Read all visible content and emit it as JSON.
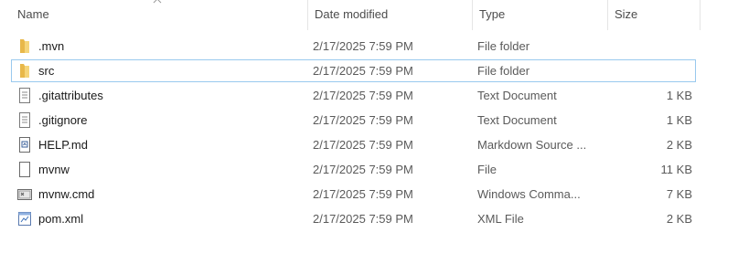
{
  "columns": {
    "name": "Name",
    "date": "Date modified",
    "type": "Type",
    "size": "Size"
  },
  "rows": [
    {
      "name": ".mvn",
      "date": "2/17/2025 7:59 PM",
      "type": "File folder",
      "size": "",
      "icon": "folder-icon"
    },
    {
      "name": "src",
      "date": "2/17/2025 7:59 PM",
      "type": "File folder",
      "size": "",
      "icon": "folder-icon",
      "selected": true
    },
    {
      "name": ".gitattributes",
      "date": "2/17/2025 7:59 PM",
      "type": "Text Document",
      "size": "1 KB",
      "icon": "text-file-icon"
    },
    {
      "name": ".gitignore",
      "date": "2/17/2025 7:59 PM",
      "type": "Text Document",
      "size": "1 KB",
      "icon": "text-file-icon"
    },
    {
      "name": "HELP.md",
      "date": "2/17/2025 7:59 PM",
      "type": "Markdown Source ...",
      "size": "2 KB",
      "icon": "markdown-file-icon"
    },
    {
      "name": "mvnw",
      "date": "2/17/2025 7:59 PM",
      "type": "File",
      "size": "11 KB",
      "icon": "blank-file-icon"
    },
    {
      "name": "mvnw.cmd",
      "date": "2/17/2025 7:59 PM",
      "type": "Windows Comma...",
      "size": "7 KB",
      "icon": "cmd-file-icon"
    },
    {
      "name": "pom.xml",
      "date": "2/17/2025 7:59 PM",
      "type": "XML File",
      "size": "2 KB",
      "icon": "xml-file-icon"
    }
  ]
}
